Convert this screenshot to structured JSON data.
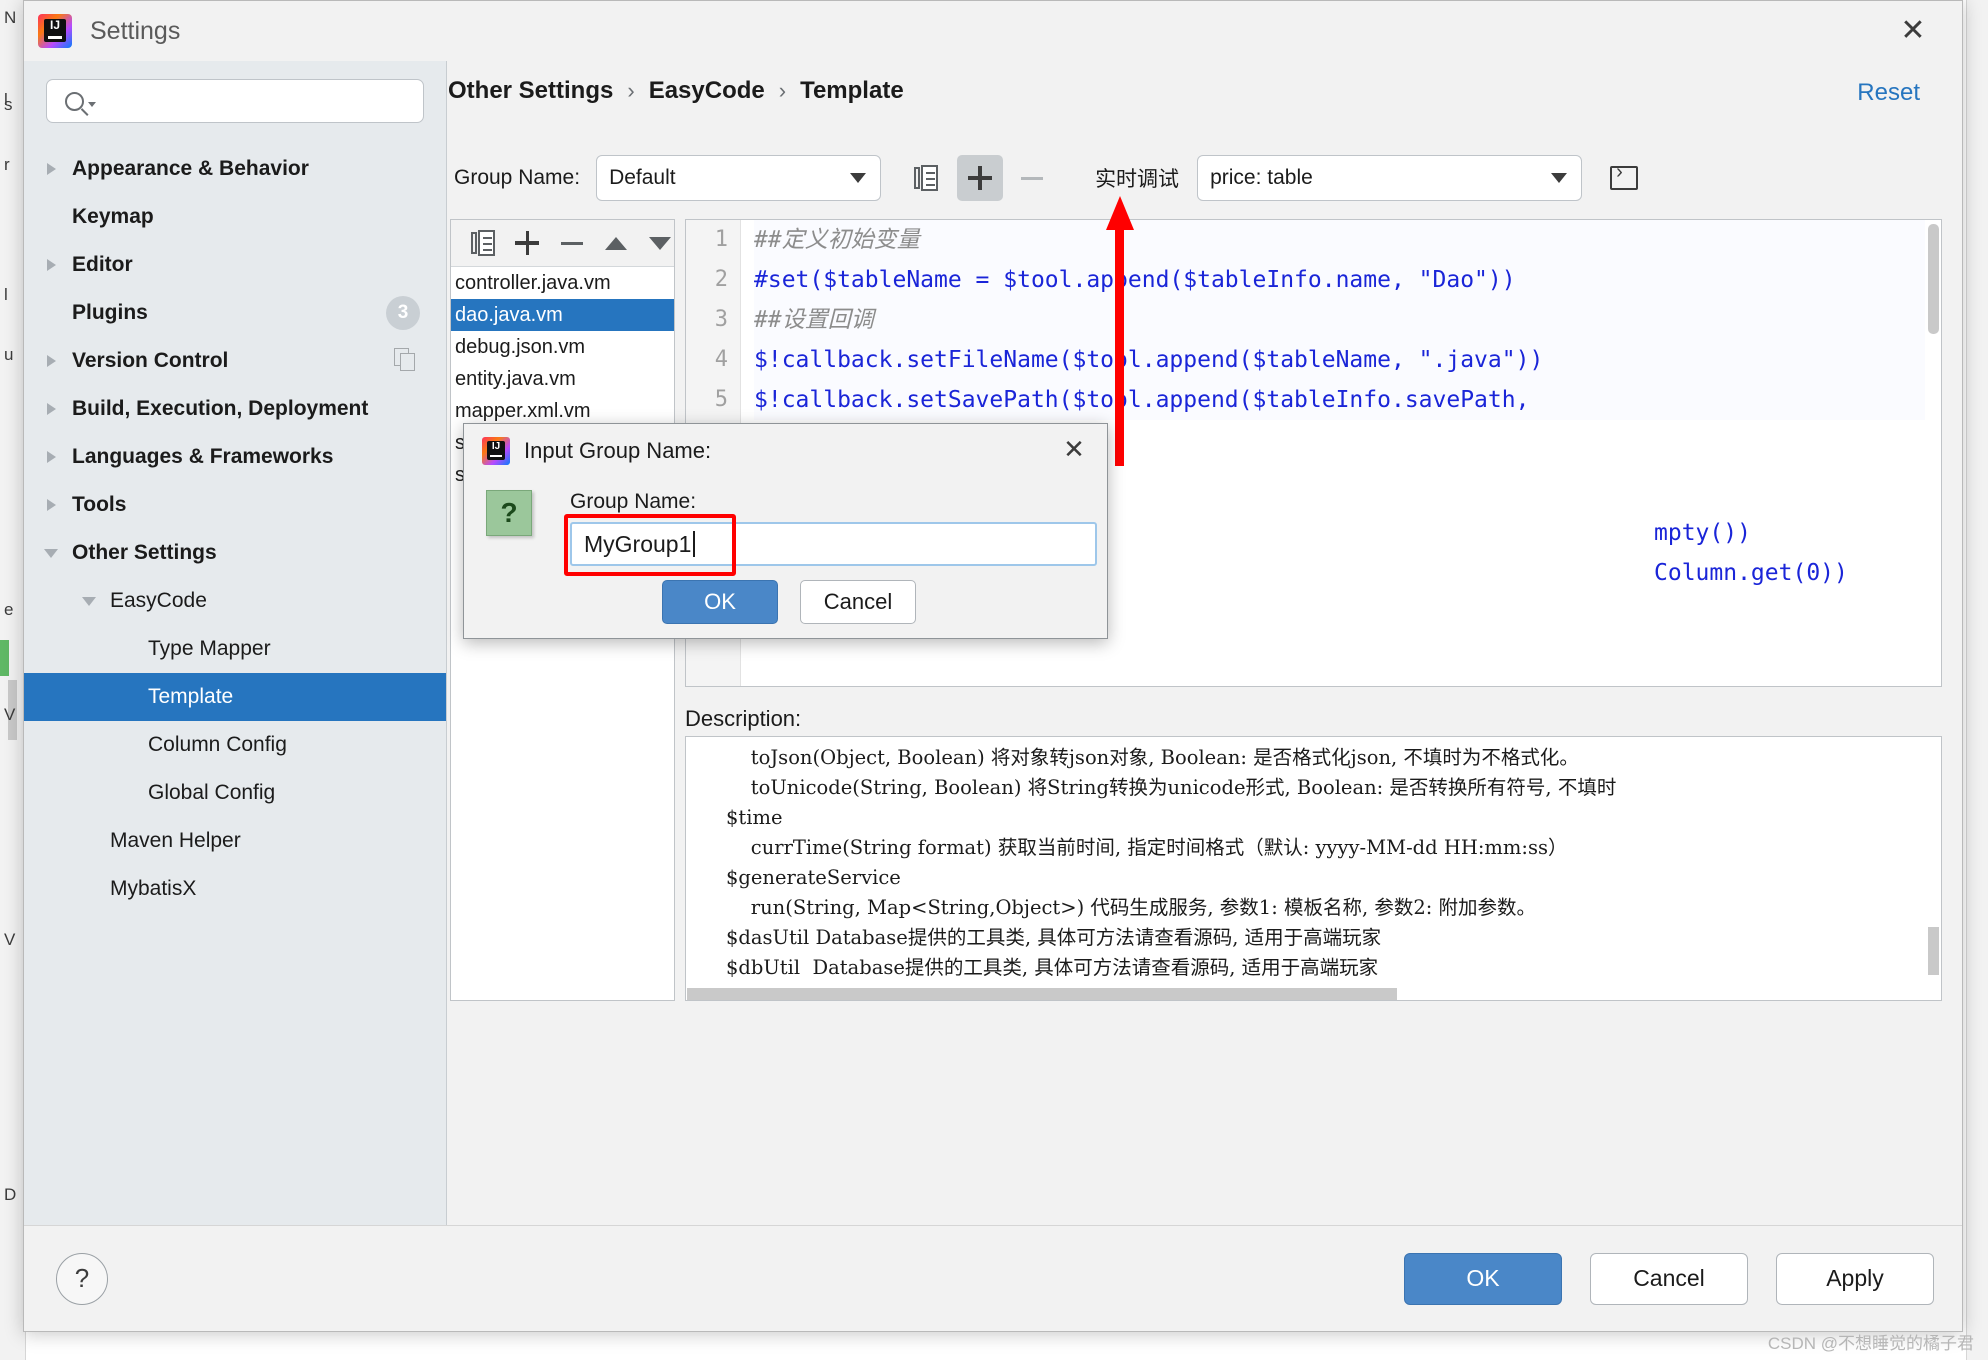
{
  "window": {
    "title": "Settings",
    "close_label": "✕",
    "logo_text": "IJ"
  },
  "backdrop": {
    "left_letters": [
      "N",
      "s",
      "l",
      "u",
      "e",
      "V",
      "V",
      "D"
    ],
    "right_letters": [
      "l",
      "r"
    ]
  },
  "sidebar": {
    "search": {
      "value": "",
      "placeholder": ""
    },
    "items": [
      {
        "label": "Appearance & Behavior",
        "twisty": "closed",
        "bold": true,
        "indent": 0,
        "selected": false,
        "badge": ""
      },
      {
        "label": "Keymap",
        "twisty": "none",
        "bold": true,
        "indent": 0,
        "selected": false,
        "badge": ""
      },
      {
        "label": "Editor",
        "twisty": "closed",
        "bold": true,
        "indent": 0,
        "selected": false,
        "badge": ""
      },
      {
        "label": "Plugins",
        "twisty": "none",
        "bold": true,
        "indent": 0,
        "selected": false,
        "badge": "3"
      },
      {
        "label": "Version Control",
        "twisty": "closed",
        "bold": true,
        "indent": 0,
        "selected": false,
        "badge": "copy"
      },
      {
        "label": "Build, Execution, Deployment",
        "twisty": "closed",
        "bold": true,
        "indent": 0,
        "selected": false,
        "badge": ""
      },
      {
        "label": "Languages & Frameworks",
        "twisty": "closed",
        "bold": true,
        "indent": 0,
        "selected": false,
        "badge": ""
      },
      {
        "label": "Tools",
        "twisty": "closed",
        "bold": true,
        "indent": 0,
        "selected": false,
        "badge": ""
      },
      {
        "label": "Other Settings",
        "twisty": "open",
        "bold": true,
        "indent": 0,
        "selected": false,
        "badge": ""
      },
      {
        "label": "EasyCode",
        "twisty": "open",
        "bold": false,
        "indent": 1,
        "selected": false,
        "badge": ""
      },
      {
        "label": "Type Mapper",
        "twisty": "none",
        "bold": false,
        "indent": 2,
        "selected": false,
        "badge": ""
      },
      {
        "label": "Template",
        "twisty": "none",
        "bold": false,
        "indent": 2,
        "selected": true,
        "badge": ""
      },
      {
        "label": "Column Config",
        "twisty": "none",
        "bold": false,
        "indent": 2,
        "selected": false,
        "badge": ""
      },
      {
        "label": "Global Config",
        "twisty": "none",
        "bold": false,
        "indent": 2,
        "selected": false,
        "badge": ""
      },
      {
        "label": "Maven Helper",
        "twisty": "none",
        "bold": false,
        "indent": 1,
        "selected": false,
        "badge": ""
      },
      {
        "label": "MybatisX",
        "twisty": "none",
        "bold": false,
        "indent": 1,
        "selected": false,
        "badge": ""
      }
    ]
  },
  "main": {
    "breadcrumb": [
      "Other Settings",
      "EasyCode",
      "Template"
    ],
    "breadcrumb_separator": "›",
    "reset_label": "Reset",
    "toolbar": {
      "group_name_label": "Group Name:",
      "group_name_value": "Default",
      "copy_icon": "copy-icon",
      "add_icon": "plus-icon",
      "remove_icon": "minus-icon",
      "debug_label": "实时调试",
      "debug_value": "price: table",
      "run_icon": "run-icon"
    },
    "filelist": {
      "toolbar_icons": [
        "copy-icon",
        "plus-icon",
        "minus-icon",
        "move-up-icon",
        "move-down-icon"
      ],
      "items": [
        {
          "name": "controller.java.vm",
          "selected": false
        },
        {
          "name": "dao.java.vm",
          "selected": true
        },
        {
          "name": "debug.json.vm",
          "selected": false
        },
        {
          "name": "entity.java.vm",
          "selected": false
        },
        {
          "name": "mapper.xml.vm",
          "selected": false
        },
        {
          "name": "service.java.vm",
          "selected": false
        },
        {
          "name": "serviceImpl.java.vm",
          "selected": false
        }
      ]
    },
    "editor": {
      "lines": [
        {
          "no": "1",
          "text": "##定义初始变量",
          "kind": "comment"
        },
        {
          "no": "2",
          "text": "#set($tableName = $tool.append($tableInfo.name, \"Dao\"))",
          "kind": "code"
        },
        {
          "no": "3",
          "text": "##设置回调",
          "kind": "comment"
        },
        {
          "no": "4",
          "text": "$!callback.setFileName($tool.append($tableName, \".java\"))",
          "kind": "code"
        },
        {
          "no": "5",
          "text": "$!callback.setSavePath($tool.append($tableInfo.savePath,",
          "kind": "code"
        },
        {
          "no": "6",
          "text": "",
          "kind": "plain"
        }
      ],
      "hidden_fragments": [
        "mpty())",
        "Column.get(0))"
      ]
    },
    "description": {
      "label": "Description:",
      "lines": [
        "    toJson(Object, Boolean) 将对象转json对象, Boolean: 是否格式化json, 不填时为不格式化。",
        "    toUnicode(String, Boolean) 将String转换为unicode形式, Boolean: 是否转换所有符号, 不填时",
        "$time",
        "    currTime(String format) 获取当前时间, 指定时间格式（默认: yyyy-MM-dd HH:mm:ss）",
        "$generateService",
        "    run(String, Map<String,Object>) 代码生成服务, 参数1: 模板名称, 参数2: 附加参数。",
        "$dasUtil Database提供的工具类, 具体可方法请查看源码, 适用于高端玩家",
        "$dbUtil  Database提供的工具类, 具体可方法请查看源码, 适用于高端玩家"
      ]
    }
  },
  "bottombar": {
    "help_label": "?",
    "ok_label": "OK",
    "cancel_label": "Cancel",
    "apply_label": "Apply"
  },
  "dialog": {
    "title": "Input Group Name:",
    "close_label": "✕",
    "icon": "question-icon",
    "icon_glyph": "?",
    "field_label": "Group Name:",
    "field_value": "MyGroup1",
    "ok_label": "OK",
    "cancel_label": "Cancel"
  },
  "watermark": "CSDN @不想睡觉的橘子君",
  "colors": {
    "accent": "#2675bf",
    "primary_button": "#4a87c8",
    "annotation_red": "#ff0000",
    "sidebar_bg": "#e6eaed",
    "code_blue": "#1a25d8",
    "comment_gray": "#8c8c8c"
  }
}
